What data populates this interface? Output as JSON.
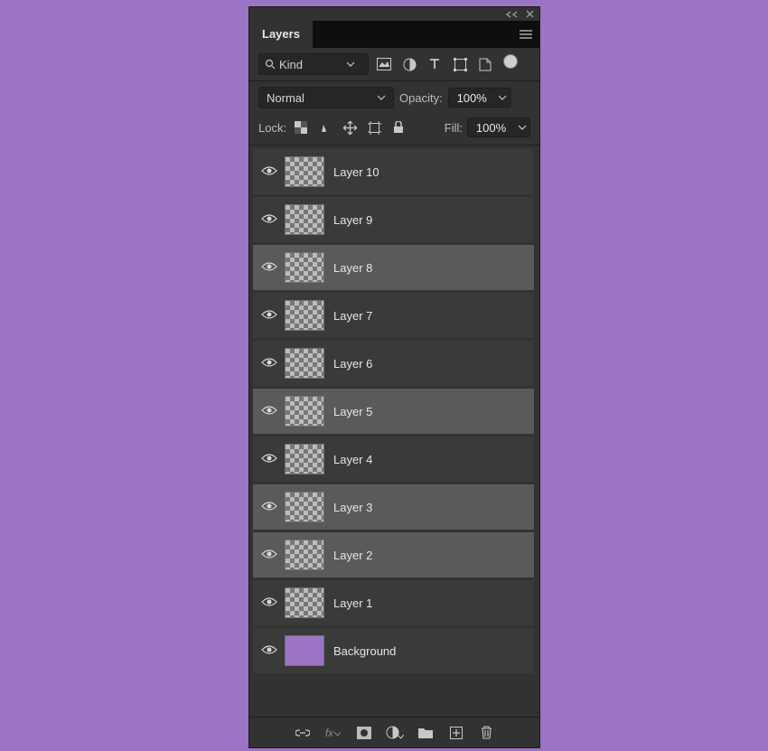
{
  "panel": {
    "title": "Layers",
    "search_placeholder": "Kind",
    "blend_mode": "Normal",
    "opacity_label": "Opacity:",
    "opacity_value": "100%",
    "lock_label": "Lock:",
    "fill_label": "Fill:",
    "fill_value": "100%",
    "fx_label": "fx"
  },
  "layers": [
    {
      "name": "Layer 10",
      "visible": true,
      "selected": false,
      "thumb": "checker"
    },
    {
      "name": "Layer 9",
      "visible": true,
      "selected": false,
      "thumb": "checker"
    },
    {
      "name": "Layer 8",
      "visible": true,
      "selected": true,
      "thumb": "checker"
    },
    {
      "name": "Layer 7",
      "visible": true,
      "selected": false,
      "thumb": "checker"
    },
    {
      "name": "Layer 6",
      "visible": true,
      "selected": false,
      "thumb": "checker"
    },
    {
      "name": "Layer 5",
      "visible": true,
      "selected": true,
      "thumb": "checker"
    },
    {
      "name": "Layer 4",
      "visible": true,
      "selected": false,
      "thumb": "checker"
    },
    {
      "name": "Layer 3",
      "visible": true,
      "selected": true,
      "thumb": "checker"
    },
    {
      "name": "Layer 2",
      "visible": true,
      "selected": true,
      "thumb": "checker"
    },
    {
      "name": "Layer 1",
      "visible": true,
      "selected": false,
      "thumb": "checker"
    },
    {
      "name": "Background",
      "visible": true,
      "selected": false,
      "thumb": "solid-purple"
    }
  ]
}
